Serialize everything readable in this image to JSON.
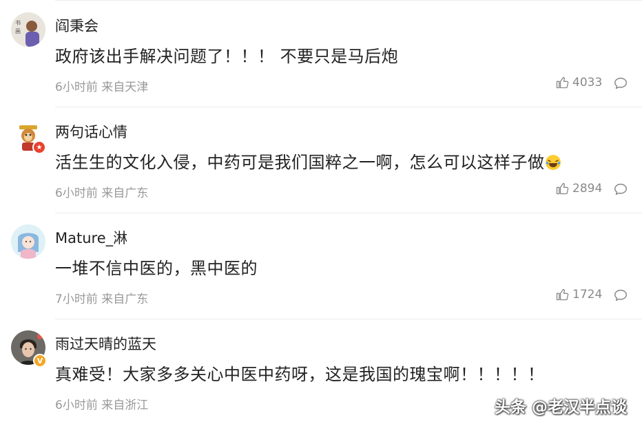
{
  "comments": [
    {
      "username": "阎秉会",
      "text": "政府该出手解决问题了！！！ 不要只是马后炮",
      "time": "6小时前",
      "location": "来自天津",
      "likes": "4033",
      "avatar_icon": "man-portrait-avatar",
      "badge": null
    },
    {
      "username": "两句话心情",
      "text": "活生生的文化入侵，中药可是我们国粹之一啊，怎么可以这样子做",
      "emoji": "laughing-tears-emoji",
      "time": "6小时前",
      "location": "来自广东",
      "likes": "2894",
      "avatar_icon": "cartoon-monkey-avatar",
      "badge": "red-star-badge"
    },
    {
      "username": "Mature_淋",
      "text": "一堆不信中医的，黑中医的",
      "time": "7小时前",
      "location": "来自广东",
      "likes": "1724",
      "avatar_icon": "anime-girl-avatar",
      "badge": null
    },
    {
      "username": "雨过天晴的蓝天",
      "text": "真难受！大家多多关心中医中药呀，这是我国的瑰宝啊！！！！！",
      "time": "6小时前",
      "location": "来自浙江",
      "likes": "",
      "avatar_icon": "young-man-avatar",
      "badge": "verified-v-badge",
      "badge_text": "V"
    }
  ],
  "watermark": "头条 @老汉半点谈",
  "colors": {
    "text": "#222222",
    "meta": "#999999",
    "separator": "#ececec",
    "verified": "#f5a623",
    "star_badge": "#e8422f"
  }
}
